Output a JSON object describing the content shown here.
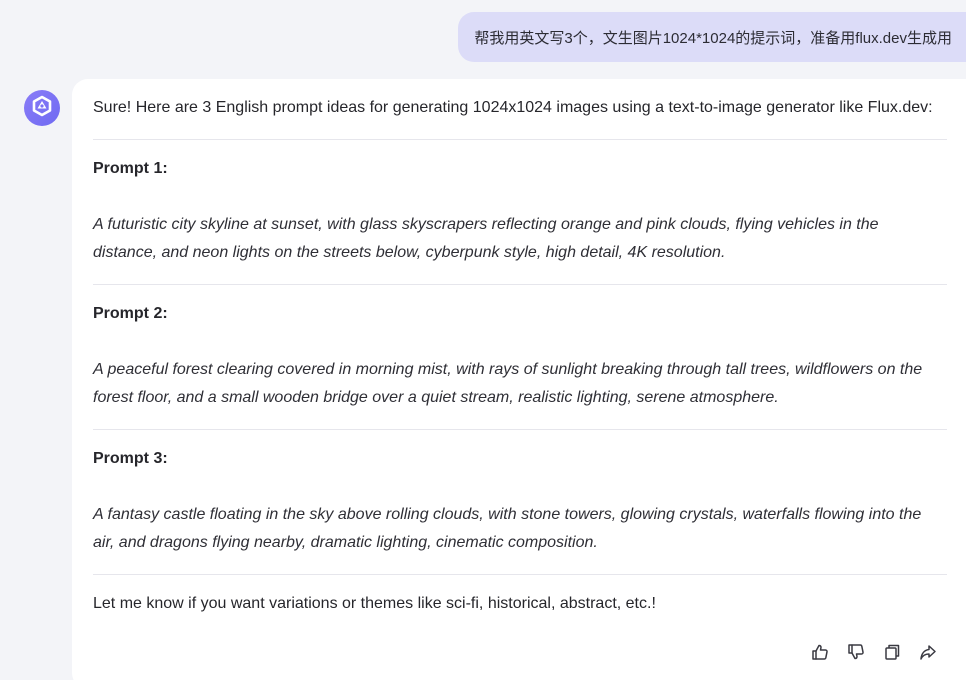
{
  "user_message": {
    "text": "帮我用英文写3个，文生图片1024*1024的提示词，准备用flux.dev生成用"
  },
  "assistant": {
    "avatar_icon": "assistant-logo-icon",
    "intro": "Sure! Here are 3 English prompt ideas for generating 1024x1024 images using a text-to-image generator like Flux.dev:",
    "prompts": [
      {
        "title": "Prompt 1:",
        "text": "A futuristic city skyline at sunset, with glass skyscrapers reflecting orange and pink clouds, flying vehicles in the distance, and neon lights on the streets below, cyberpunk style, high detail, 4K resolution."
      },
      {
        "title": "Prompt 2:",
        "text": "A peaceful forest clearing covered in morning mist, with rays of sunlight breaking through tall trees, wildflowers on the forest floor, and a small wooden bridge over a quiet stream, realistic lighting, serene atmosphere."
      },
      {
        "title": "Prompt 3:",
        "text": "A fantasy castle floating in the sky above rolling clouds, with stone towers, glowing crystals, waterfalls flowing into the air, and dragons flying nearby, dramatic lighting, cinematic composition."
      }
    ],
    "outro": "Let me know if you want variations or themes like sci-fi, historical, abstract, etc.!",
    "actions": [
      {
        "name": "like",
        "icon": "thumbs-up-icon"
      },
      {
        "name": "dislike",
        "icon": "thumbs-down-icon"
      },
      {
        "name": "copy",
        "icon": "copy-icon"
      },
      {
        "name": "share",
        "icon": "share-icon"
      }
    ]
  },
  "colors": {
    "background": "#f3f4f8",
    "user_bubble": "#dcdcf8",
    "card": "#ffffff",
    "accent": "#7b72f5"
  }
}
